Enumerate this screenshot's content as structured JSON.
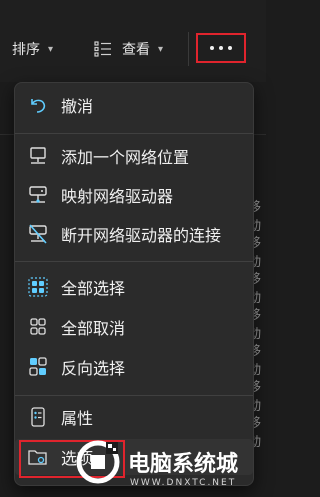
{
  "toolbar": {
    "sort_label": "排序",
    "view_label": "查看",
    "sort_chevron": "⌄",
    "view_chevron": "⌄"
  },
  "background": {
    "row_tail": "移动"
  },
  "menu": {
    "undo": "撤消",
    "add_network_location": "添加一个网络位置",
    "map_network_drive": "映射网络驱动器",
    "disconnect_network_drive": "断开网络驱动器的连接",
    "select_all": "全部选择",
    "select_none": "全部取消",
    "invert_selection": "反向选择",
    "properties": "属性",
    "options": "选项"
  },
  "watermark": {
    "text": "电脑系统城",
    "url": "WWW.DNXTC.NET"
  },
  "colors": {
    "accent": "#60cdff",
    "highlight_border": "#e0242d"
  }
}
